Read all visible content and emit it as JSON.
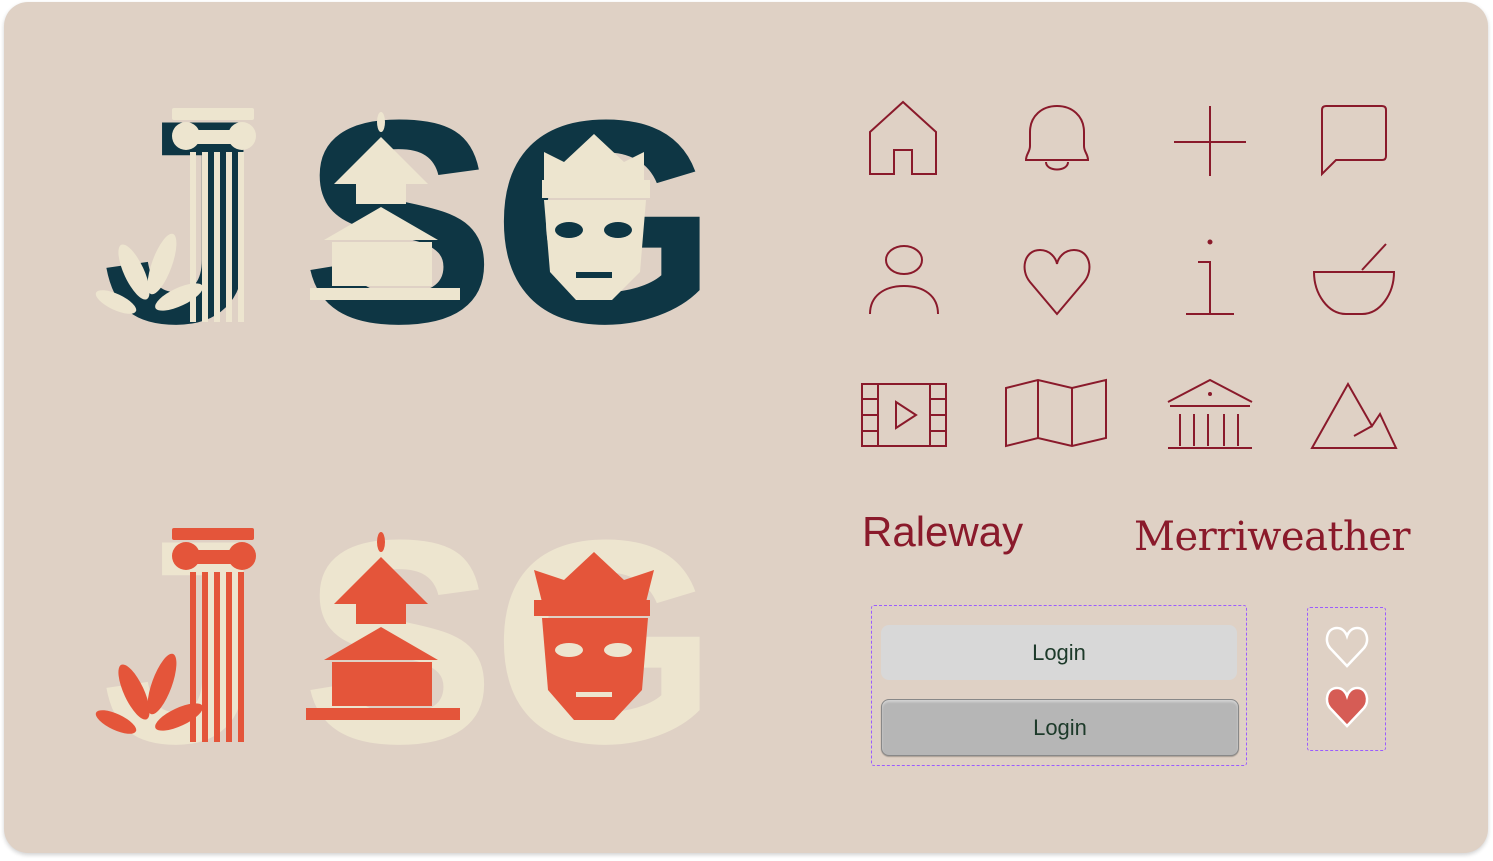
{
  "logos": {
    "dark": {
      "letters": [
        "J",
        "S",
        "G"
      ],
      "letter_color": "#0e3644",
      "motif_color": "#ede5cf"
    },
    "light": {
      "letters": [
        "J",
        "S",
        "G"
      ],
      "letter_color": "#ede5cf",
      "motif_color": "#e4553a"
    }
  },
  "icons": [
    "home-icon",
    "bell-icon",
    "plus-icon",
    "chat-bubble-icon",
    "user-icon",
    "heart-icon",
    "info-icon",
    "bowl-icon",
    "film-icon",
    "map-icon",
    "museum-icon",
    "mountain-icon"
  ],
  "icon_color": "#8a1a2b",
  "fonts": {
    "sample_sans": "Raleway",
    "sample_serif": "Merriweather"
  },
  "buttons": {
    "flat_label": "Login",
    "raised_label": "Login"
  },
  "favorites": {
    "outline": "heart-outline-icon",
    "filled": "heart-filled-icon",
    "fill_color": "#d65c55"
  },
  "colors": {
    "background": "#dfd1c5",
    "dashed_border": "#9b5cff"
  }
}
